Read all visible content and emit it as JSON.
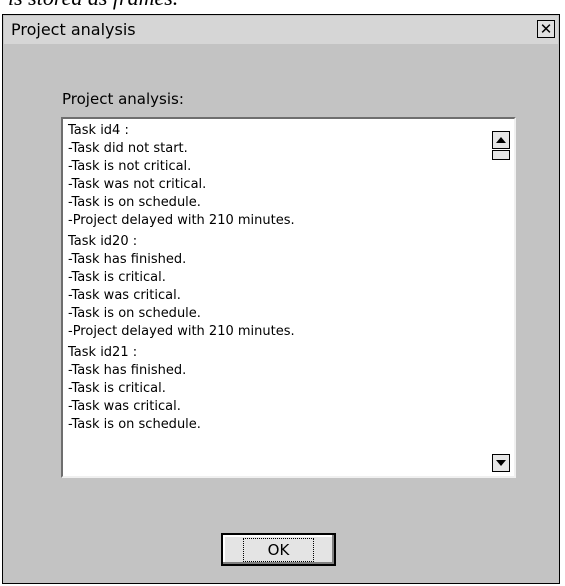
{
  "caption_fragment": "is stored as frames.",
  "window": {
    "title": "Project analysis",
    "close_symbol": "✕"
  },
  "label": "Project analysis:",
  "tasks": [
    {
      "header": "Task id4 :",
      "lines": [
        "-Task did not start.",
        "-Task is not critical.",
        "-Task was not critical.",
        "-Task is on schedule.",
        "-Project delayed with 210 minutes."
      ]
    },
    {
      "header": "Task id20 :",
      "lines": [
        "-Task has finished.",
        "-Task is critical.",
        "-Task was critical.",
        "-Task is on schedule.",
        "-Project delayed with 210 minutes."
      ]
    },
    {
      "header": "Task id21 :",
      "lines": [
        "-Task has finished.",
        "-Task is critical.",
        "-Task was critical.",
        "-Task is on schedule."
      ]
    }
  ],
  "buttons": {
    "ok": "OK"
  },
  "icons": {
    "close": "close-icon",
    "scroll_up": "arrow-up-icon",
    "scroll_down": "arrow-down-icon"
  }
}
